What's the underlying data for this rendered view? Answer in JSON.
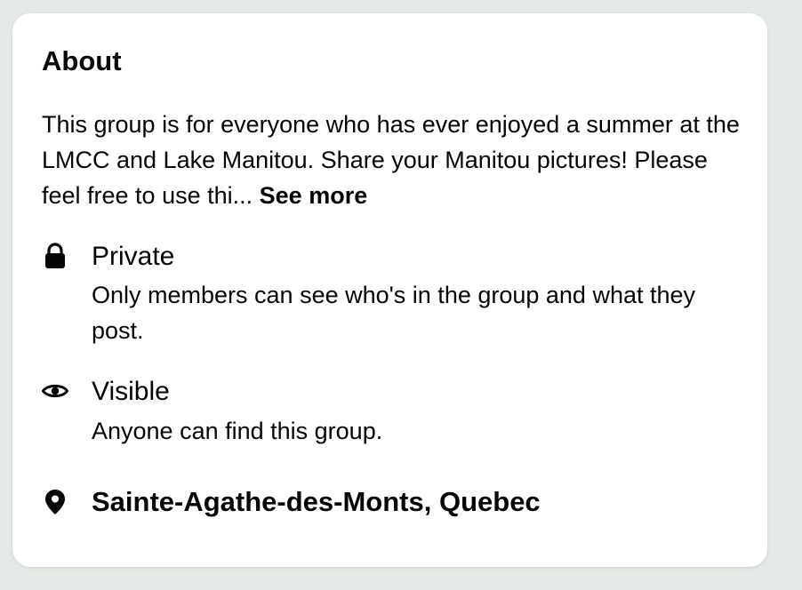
{
  "about": {
    "title": "About",
    "description": "This group is for everyone who has ever enjoyed a summer at the LMCC and Lake Manitou. Share your Manitou pictures! Please feel free to use thi...",
    "see_more_label": "See more"
  },
  "privacy": {
    "icon": "lock-icon",
    "title": "Private",
    "subtitle": "Only members can see who's in the group and what they post."
  },
  "visibility": {
    "icon": "eye-icon",
    "title": "Visible",
    "subtitle": "Anyone can find this group."
  },
  "location": {
    "icon": "map-pin-icon",
    "title": "Sainte-Agathe-des-Monts, Quebec"
  },
  "colors": {
    "background": "#e3e9e4",
    "card": "#ffffff",
    "text": "#050505"
  }
}
